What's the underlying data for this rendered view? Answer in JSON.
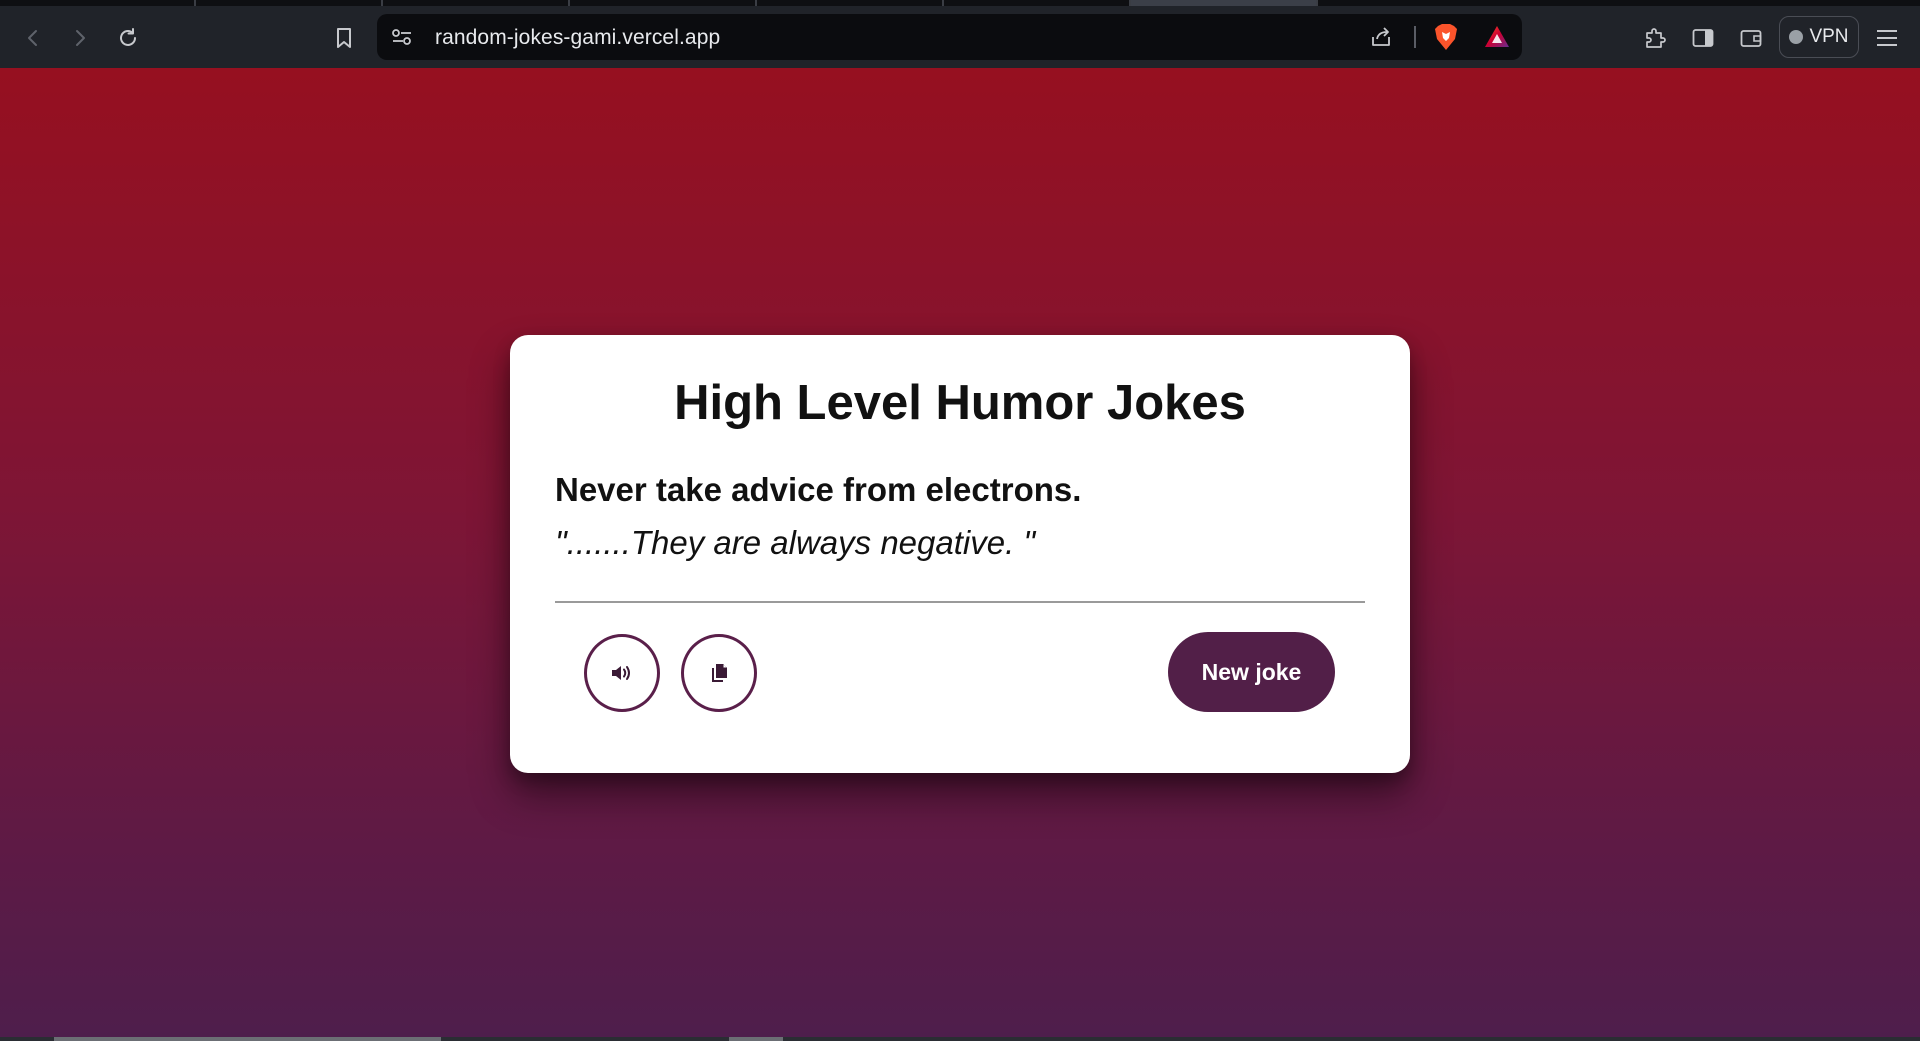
{
  "browser": {
    "url": "random-jokes-gami.vercel.app",
    "vpn_label": "VPN"
  },
  "card": {
    "title": "High Level Humor Jokes",
    "setup": "Never take advice from electrons.",
    "punchline": "\".......They are always negative. \"",
    "new_joke_label": "New joke"
  },
  "colors": {
    "accent": "#521f48",
    "background_top": "#961020",
    "background_bottom": "#4e1e4c"
  },
  "icons": {
    "speak": "volume-icon",
    "copy": "copy-icon"
  }
}
